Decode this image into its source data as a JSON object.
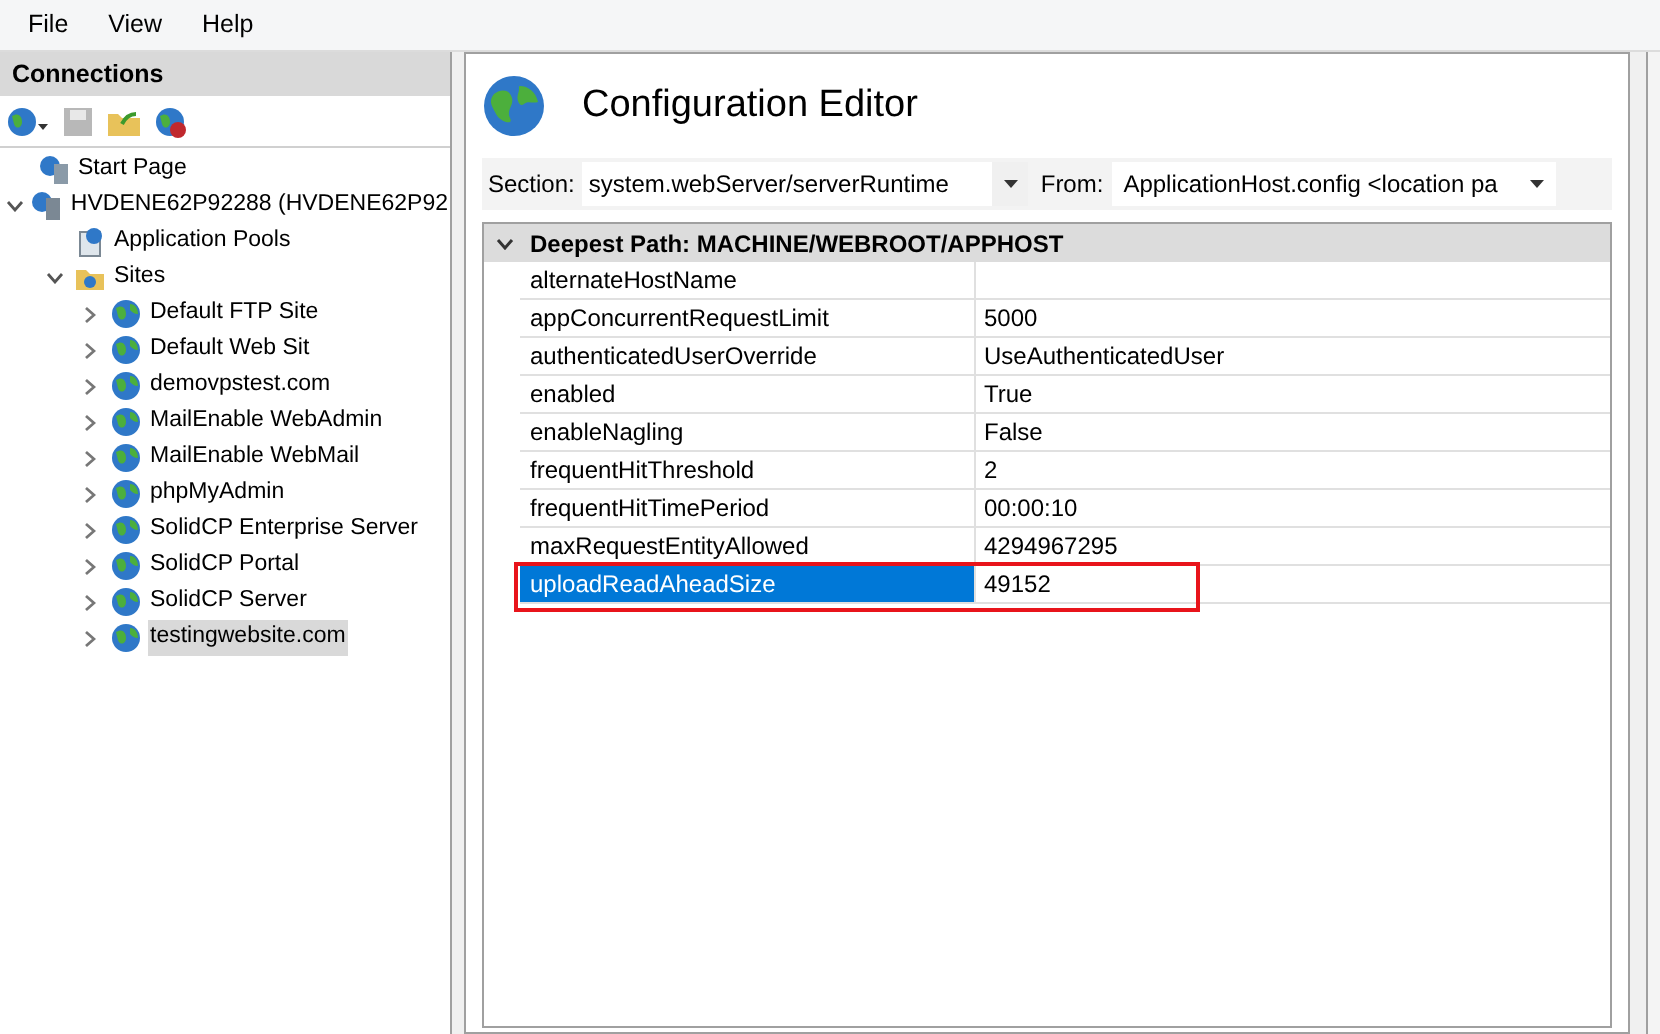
{
  "menu": [
    "File",
    "View",
    "Help"
  ],
  "connections": {
    "title": "Connections",
    "tree": [
      {
        "label": "Start Page",
        "kind": "start",
        "selected": false
      },
      {
        "label": "HVDENE62P92288 (HVDENE62P92",
        "kind": "server",
        "selected": false,
        "expanded": true,
        "children": [
          {
            "label": "Application Pools",
            "kind": "pool",
            "selected": false
          },
          {
            "label": "Sites",
            "kind": "sites",
            "selected": false,
            "expanded": true,
            "children": [
              {
                "label": "Default FTP Site",
                "kind": "site",
                "selected": false,
                "expanded": false
              },
              {
                "label": "Default Web Sit",
                "kind": "site",
                "selected": false,
                "expanded": false
              },
              {
                "label": "demovpstest.com",
                "kind": "site",
                "selected": false,
                "expanded": false
              },
              {
                "label": "MailEnable WebAdmin",
                "kind": "site",
                "selected": false,
                "expanded": false
              },
              {
                "label": "MailEnable WebMail",
                "kind": "site",
                "selected": false,
                "expanded": false
              },
              {
                "label": "phpMyAdmin",
                "kind": "site",
                "selected": false,
                "expanded": false
              },
              {
                "label": "SolidCP Enterprise Server",
                "kind": "site",
                "selected": false,
                "expanded": false
              },
              {
                "label": "SolidCP Portal",
                "kind": "site",
                "selected": false,
                "expanded": false
              },
              {
                "label": "SolidCP Server",
                "kind": "site",
                "selected": false,
                "expanded": false
              },
              {
                "label": "testingwebsite.com",
                "kind": "site",
                "selected": true,
                "expanded": false
              }
            ]
          }
        ]
      }
    ]
  },
  "editor": {
    "title": "Configuration Editor",
    "section_label": "Section:",
    "section_value": "system.webServer/serverRuntime",
    "from_label": "From:",
    "from_value": "ApplicationHost.config <location pa",
    "group": {
      "title": "Deepest Path: MACHINE/WEBROOT/APPHOST",
      "expanded": true
    },
    "rows": [
      {
        "name": "alternateHostName",
        "value": "",
        "selected": false,
        "outlined": false
      },
      {
        "name": "appConcurrentRequestLimit",
        "value": "5000",
        "selected": false,
        "outlined": false
      },
      {
        "name": "authenticatedUserOverride",
        "value": "UseAuthenticatedUser",
        "selected": false,
        "outlined": false
      },
      {
        "name": "enabled",
        "value": "True",
        "selected": false,
        "outlined": false
      },
      {
        "name": "enableNagling",
        "value": "False",
        "selected": false,
        "outlined": false
      },
      {
        "name": "frequentHitThreshold",
        "value": "2",
        "selected": false,
        "outlined": false
      },
      {
        "name": "frequentHitTimePeriod",
        "value": "00:00:10",
        "selected": false,
        "outlined": false
      },
      {
        "name": "maxRequestEntityAllowed",
        "value": "4294967295",
        "selected": false,
        "outlined": false
      },
      {
        "name": "uploadReadAheadSize",
        "value": "49152",
        "selected": true,
        "outlined": true
      }
    ]
  }
}
